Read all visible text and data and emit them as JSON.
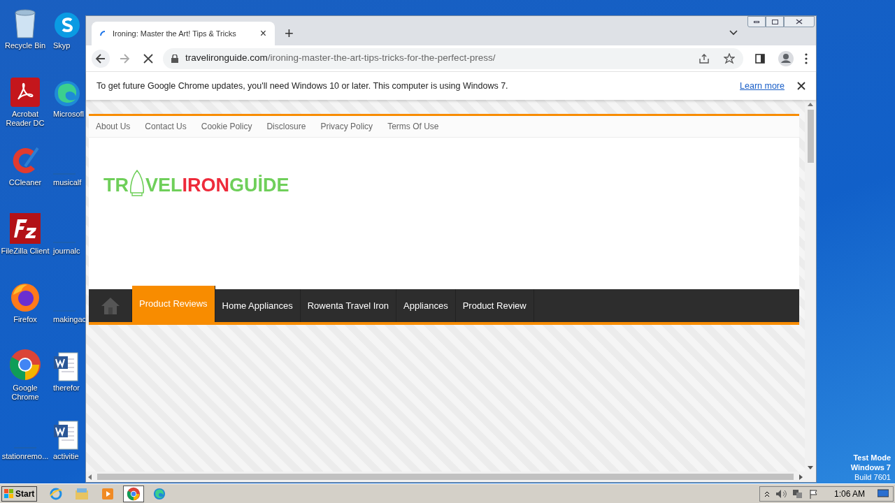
{
  "desktop": {
    "icons": [
      {
        "label": "Recycle Bin",
        "kind": "bin"
      },
      {
        "label": "Skyp",
        "kind": "skype"
      },
      {
        "label": "Acrobat Reader DC",
        "kind": "acrobat"
      },
      {
        "label": "Microsofl",
        "kind": "edge"
      },
      {
        "label": "CCleaner",
        "kind": "ccleaner"
      },
      {
        "label": "musicalf",
        "kind": "blank"
      },
      {
        "label": "FileZilla Client",
        "kind": "filezilla"
      },
      {
        "label": "journalc",
        "kind": "blank"
      },
      {
        "label": "Firefox",
        "kind": "firefox"
      },
      {
        "label": "makingac",
        "kind": "blank"
      },
      {
        "label": "Google Chrome",
        "kind": "chrome"
      },
      {
        "label": "therefor",
        "kind": "word"
      },
      {
        "label": "stationremo...",
        "kind": "blank"
      },
      {
        "label": "activitie",
        "kind": "word"
      }
    ],
    "os_notice": [
      "Test Mode",
      "Windows 7",
      "Build 7601"
    ]
  },
  "browser": {
    "tab": {
      "title": "Ironing: Master the Art! Tips & Tricks",
      "close": "×"
    },
    "new_tab": "+",
    "address": {
      "domain": "travelironguide.com",
      "path": "/ironing-master-the-art-tips-tricks-for-the-perfect-press/"
    },
    "infobar": {
      "message": "To get future Google Chrome updates, you'll need Windows 10 or later. This computer is using Windows 7.",
      "link": "Learn more"
    },
    "page": {
      "top_links": [
        "About Us",
        "Contact Us",
        "Cookie Policy",
        "Disclosure",
        "Privacy Policy",
        "Terms Of Use"
      ],
      "logo": {
        "before_icon": "TR",
        "parts": [
          {
            "text": "VEL",
            "color": "#6fcf5a"
          },
          {
            "text": "IRON",
            "color": "#ee2a3a"
          },
          {
            "text": "GUİDE",
            "color": "#6fcf5a"
          }
        ]
      },
      "nav": [
        {
          "label": "Product Reviews",
          "selected": true
        },
        {
          "label": "Home Appliances",
          "selected": false
        },
        {
          "label": "Rowenta Travel Iron",
          "selected": false
        },
        {
          "label": "Appliances",
          "selected": false
        },
        {
          "label": "Product Review",
          "selected": false
        }
      ]
    }
  },
  "taskbar": {
    "start": "Start",
    "apps": [
      {
        "kind": "ie",
        "selected": false
      },
      {
        "kind": "explorer",
        "selected": false
      },
      {
        "kind": "media",
        "selected": false
      },
      {
        "kind": "chrome",
        "selected": true
      },
      {
        "kind": "edge",
        "selected": false
      }
    ],
    "clock": "1:06 AM"
  }
}
